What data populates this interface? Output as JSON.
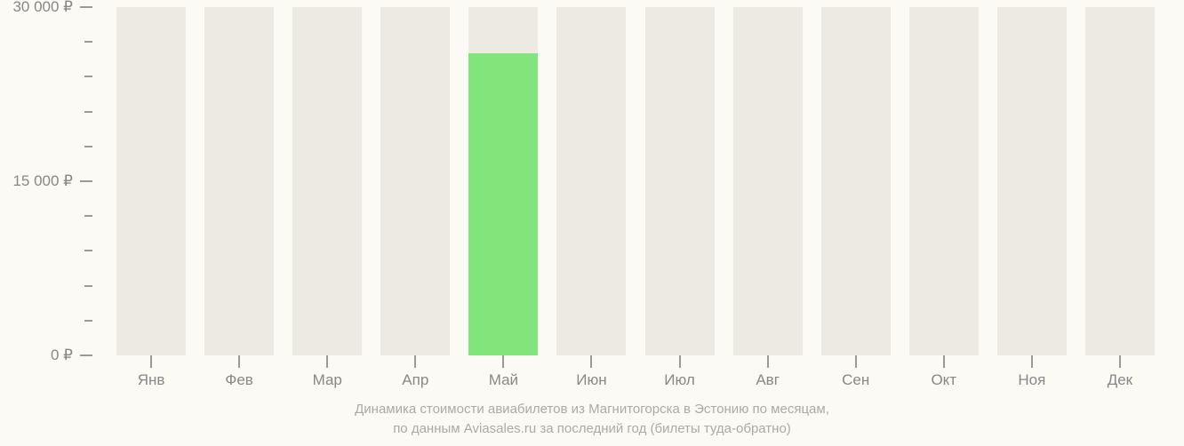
{
  "chart_data": {
    "type": "bar",
    "categories": [
      "Янв",
      "Фев",
      "Мар",
      "Апр",
      "Май",
      "Июн",
      "Июл",
      "Авг",
      "Сен",
      "Окт",
      "Ноя",
      "Дек"
    ],
    "values": [
      null,
      null,
      null,
      null,
      26000,
      null,
      null,
      null,
      null,
      null,
      null,
      null
    ],
    "ylabel": "",
    "xlabel": "",
    "ylim": [
      0,
      30000
    ],
    "y_ticks_major": [
      0,
      15000,
      30000
    ],
    "y_tick_labels": [
      "0 ₽",
      "15 000 ₽",
      "30 000 ₽"
    ],
    "minor_ticks_between": 4,
    "title": "",
    "caption_line1": "Динамика стоимости авиабилетов из Магнитогорска в Эстонию по месяцам,",
    "caption_line2": "по данным Aviasales.ru за последний год (билеты туда-обратно)"
  }
}
